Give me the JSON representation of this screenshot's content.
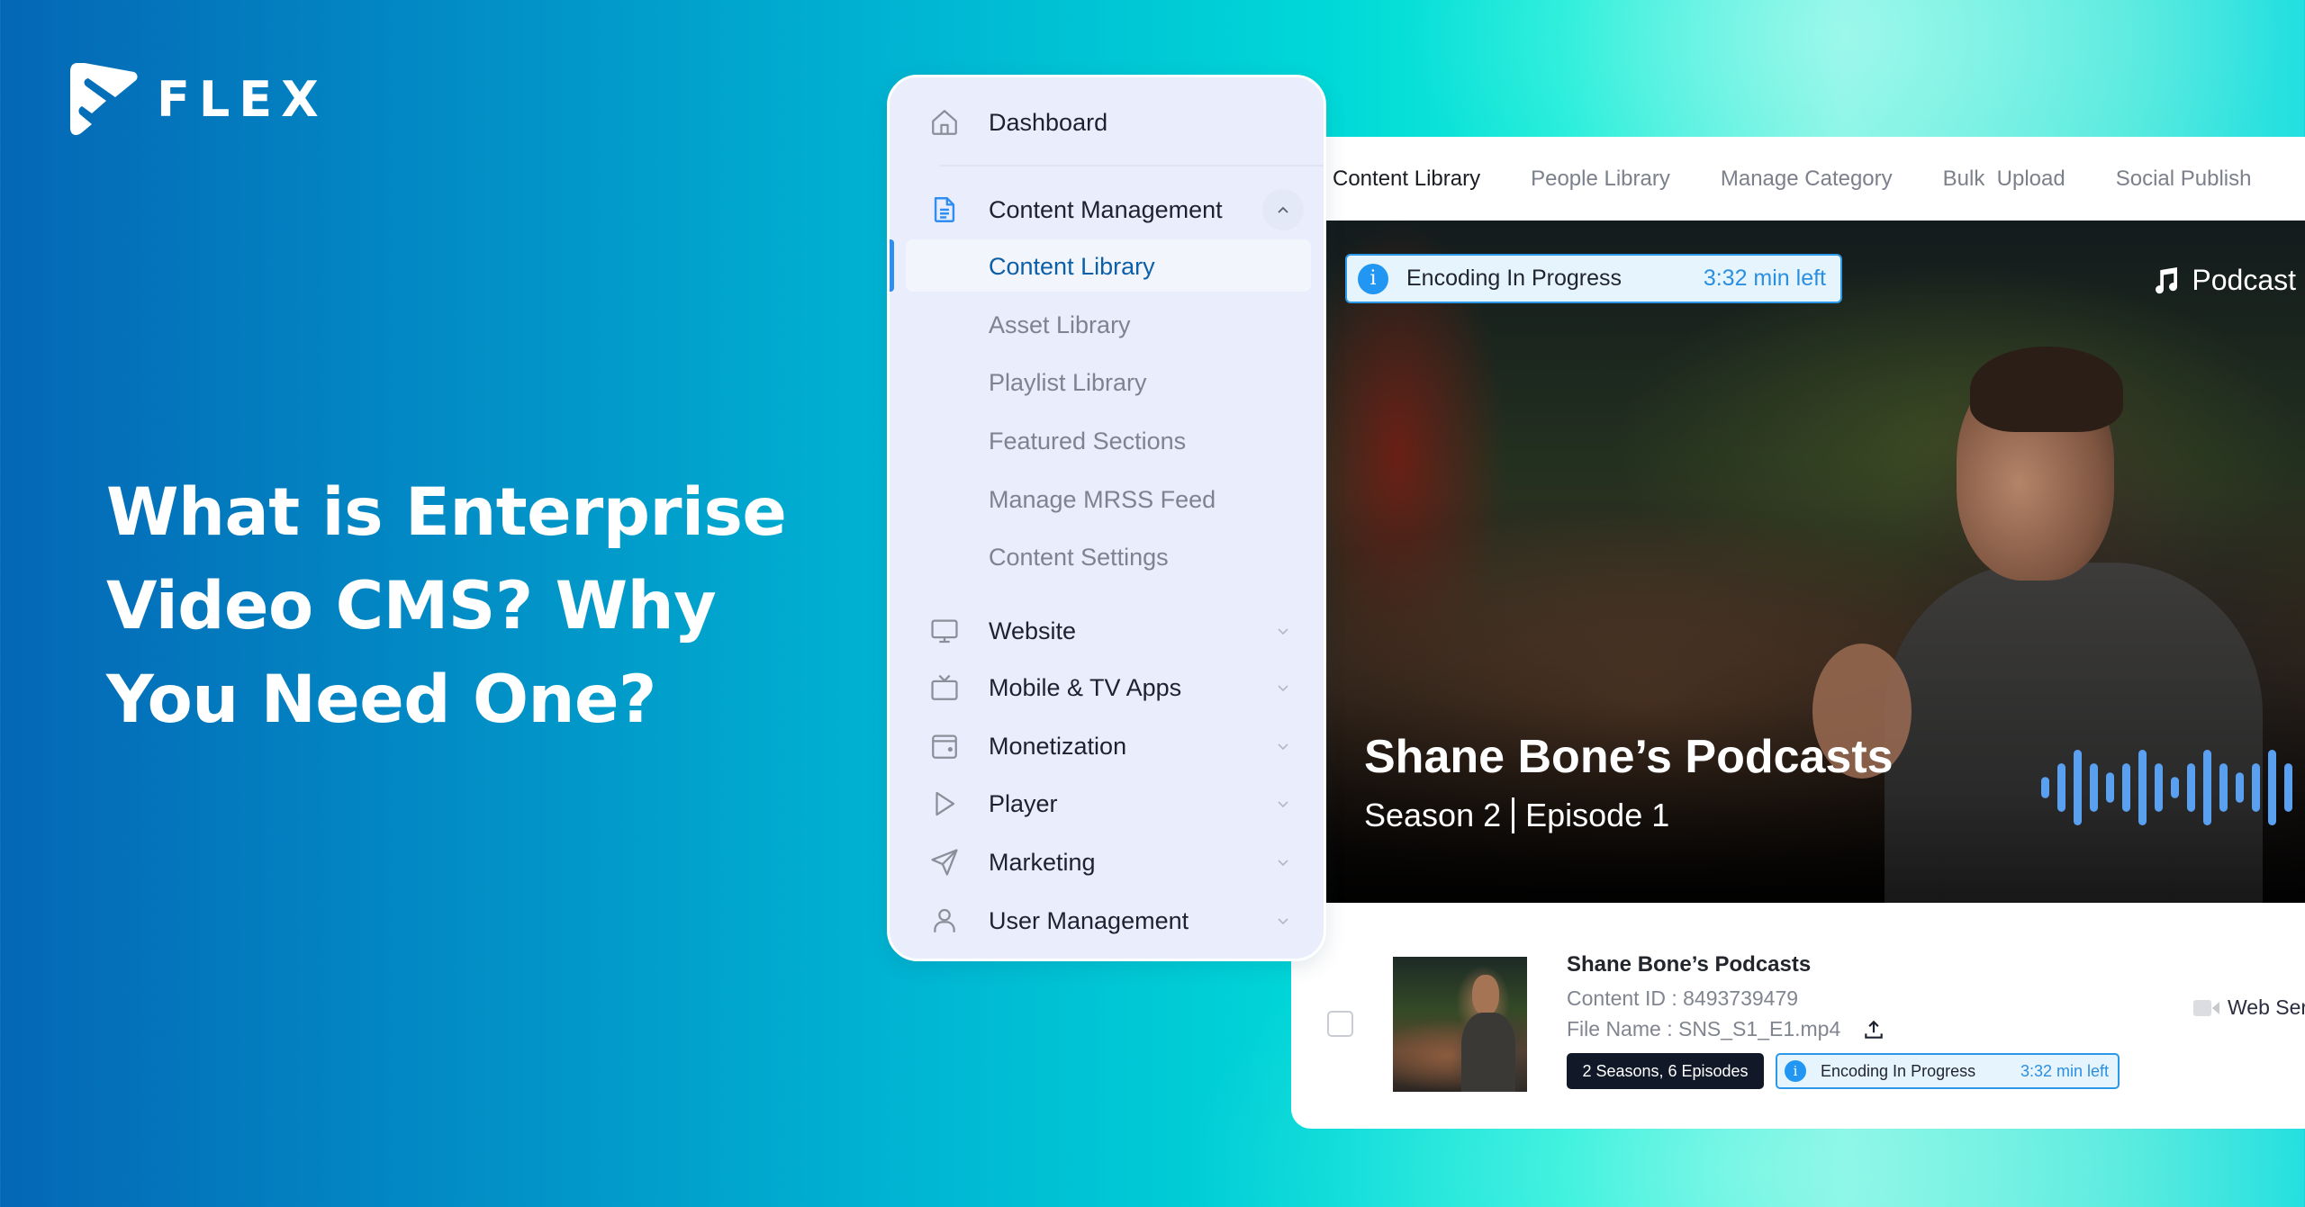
{
  "brand": {
    "logo_text": "FLEX",
    "logo_icon": "flex-play-logo"
  },
  "headline": {
    "line1": "What is Enterprise",
    "line2": "Video CMS? Why",
    "line3": "You Need One?"
  },
  "sidebar": {
    "items": [
      {
        "label": "Dashboard",
        "icon": "home-icon"
      },
      {
        "label": "Content Management",
        "icon": "document-icon",
        "expanded": true,
        "children": [
          {
            "label": "Content Library",
            "active": true
          },
          {
            "label": "Asset Library"
          },
          {
            "label": "Playlist Library"
          },
          {
            "label": "Featured Sections"
          },
          {
            "label": "Manage MRSS Feed"
          },
          {
            "label": "Content Settings"
          }
        ]
      },
      {
        "label": "Website",
        "icon": "monitor-icon"
      },
      {
        "label": "Mobile & TV Apps",
        "icon": "tv-icon"
      },
      {
        "label": "Monetization",
        "icon": "wallet-icon"
      },
      {
        "label": "Player",
        "icon": "play-icon"
      },
      {
        "label": "Marketing",
        "icon": "send-icon"
      },
      {
        "label": "User Management",
        "icon": "user-icon"
      }
    ]
  },
  "tabs": [
    {
      "label": "Content Library",
      "active": true
    },
    {
      "label": "People Library"
    },
    {
      "label": "Manage Category"
    },
    {
      "label": "Bulk  Upload"
    },
    {
      "label": "Social Publish"
    }
  ],
  "hero": {
    "encoding": {
      "label": "Encoding In Progress",
      "time_left": "3:32 min left",
      "icon": "info-icon"
    },
    "type_tag": {
      "label": "Podcast",
      "icon": "music-note-icon"
    },
    "title": "Shane Bone’s Podcasts",
    "season": "Season 2",
    "episode": "Episode 1",
    "waveform_levels": [
      0.28,
      0.64,
      1.0,
      0.64,
      0.4,
      0.64,
      1.0,
      0.64,
      0.28,
      0.64,
      1.0,
      0.64,
      0.4,
      0.64,
      1.0,
      0.64
    ],
    "waveform_color": "#5aa0f0"
  },
  "content_row": {
    "title": "Shane Bone’s Podcasts",
    "content_id": "Content ID : 8493739479",
    "file_name": "File Name : SNS_S1_E1.mp4",
    "seasons_badge": "2 Seasons, 6 Episodes",
    "encoding": {
      "label": "Encoding In Progress",
      "time_left": "3:32 min left"
    },
    "type": "Web Ser"
  },
  "colors": {
    "accent_blue": "#2196f3",
    "active_nav": "#0b5fa8",
    "badge_dark": "#111827"
  }
}
